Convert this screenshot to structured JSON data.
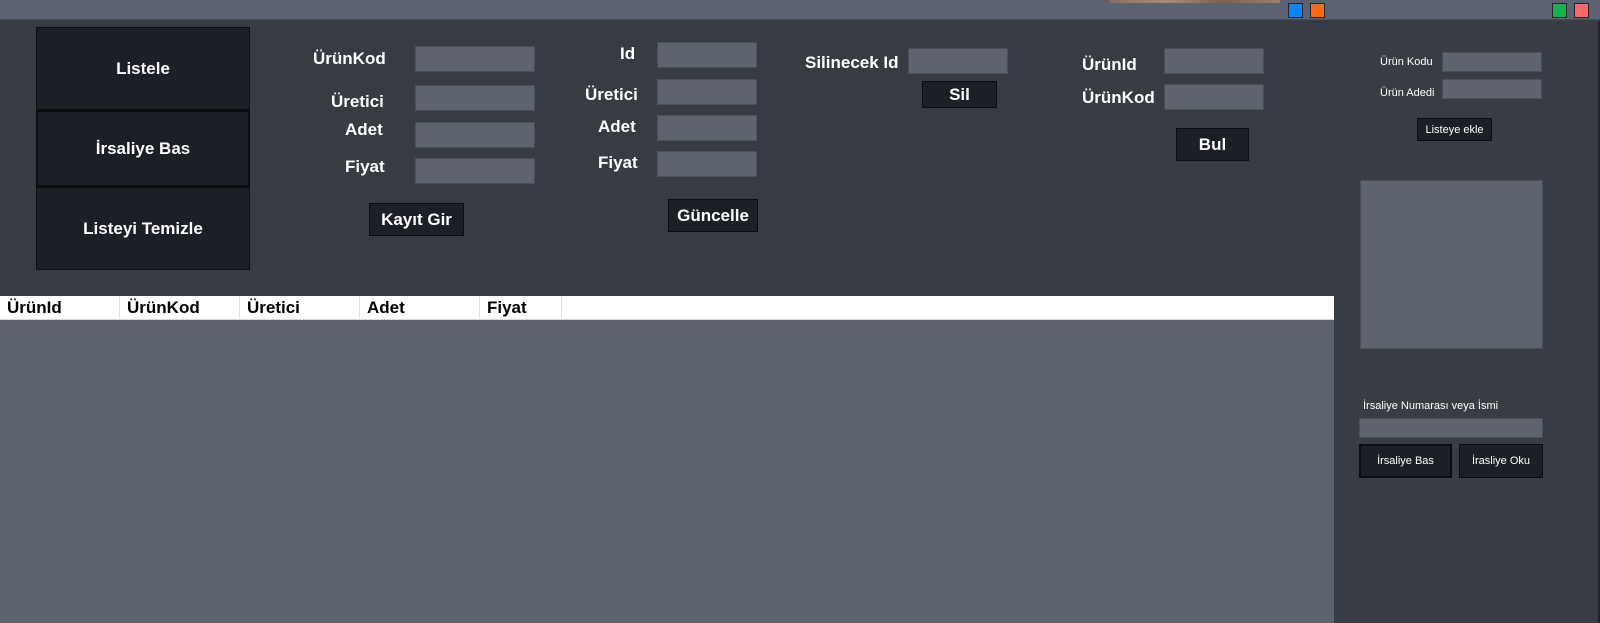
{
  "nav": {
    "list_label": "Listele",
    "print_waybill_label": "İrsaliye Bas",
    "clear_list_label": "Listeyi Temizle"
  },
  "add_form": {
    "urunkod_label": "ÜrünKod",
    "uretici_label": "Üretici",
    "adet_label": "Adet",
    "fiyat_label": "Fiyat",
    "urunkod_value": "",
    "uretici_value": "",
    "adet_value": "",
    "fiyat_value": "",
    "submit_label": "Kayıt Gir"
  },
  "update_form": {
    "id_label": "Id",
    "uretici_label": "Üretici",
    "adet_label": "Adet",
    "fiyat_label": "Fiyat",
    "id_value": "",
    "uretici_value": "",
    "adet_value": "",
    "fiyat_value": "",
    "submit_label": "Güncelle"
  },
  "delete_form": {
    "id_label": "Silinecek Id",
    "id_value": "",
    "submit_label": "Sil"
  },
  "search_form": {
    "urunid_label": "ÜrünId",
    "urunkod_label": "ÜrünKod",
    "urunid_value": "",
    "urunkod_value": "",
    "submit_label": "Bul"
  },
  "waybill_panel": {
    "product_code_label": "Ürün Kodu",
    "product_qty_label": "Ürün Adedi",
    "product_code_value": "",
    "product_qty_value": "",
    "add_to_list_label": "Listeye ekle",
    "waybill_name_label": "İrsaliye Numarası veya İsmi",
    "waybill_name_value": "",
    "print_label": "İrsaliye Bas",
    "read_label": "İrasliye Oku"
  },
  "table": {
    "columns": [
      "ÜrünId",
      "ÜrünKod",
      "Üretici",
      "Adet",
      "Fiyat"
    ],
    "rows": []
  },
  "window_controls": {
    "colors": [
      "#0a84ff",
      "#ff6a13",
      "#12b34a",
      "#ff6868"
    ]
  }
}
